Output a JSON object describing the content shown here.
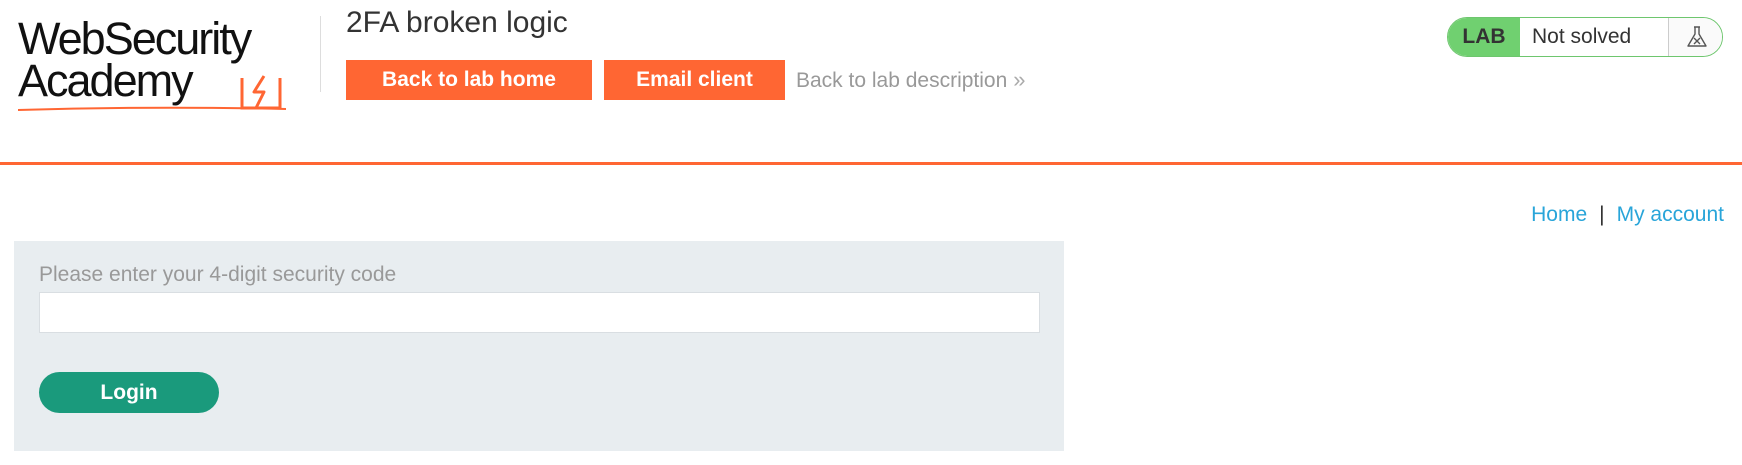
{
  "brand": {
    "line1": "WebSecurity",
    "line2": "Academy",
    "accent_color": "#ff6633",
    "logo_icon": "lightning-bolt-icon"
  },
  "lab": {
    "title": "2FA broken logic",
    "back_home_label": "Back to lab home",
    "email_client_label": "Email client",
    "back_description_label": "Back to lab description",
    "back_description_icon": "double-chevron-right-icon",
    "status_badge": "LAB",
    "status_text": "Not solved",
    "status_icon": "flask-icon",
    "status_color": "#70d070"
  },
  "nav": {
    "home_label": "Home",
    "separator": "|",
    "my_account_label": "My account",
    "link_color": "#29a5d9"
  },
  "login_form": {
    "field_label": "Please enter your 4-digit security code",
    "code_value": "",
    "code_placeholder": "",
    "submit_label": "Login",
    "submit_color": "#1a9a7c"
  }
}
